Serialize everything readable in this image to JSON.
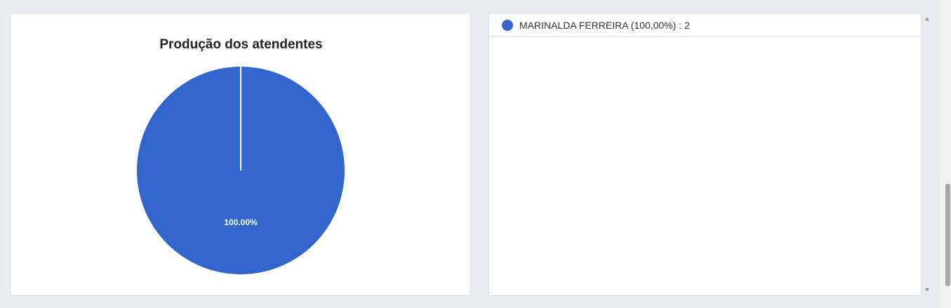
{
  "chart_data": {
    "type": "pie",
    "title": "Produção dos atendentes",
    "slices": [
      {
        "label": "MARINALDA FERREIRA",
        "value": 2,
        "percent_label": "100.00%",
        "color": "#3366cc"
      }
    ]
  },
  "legend": {
    "items": [
      {
        "text": "MARINALDA FERREIRA (100,00%) : 2",
        "color": "#3366cc"
      }
    ]
  }
}
